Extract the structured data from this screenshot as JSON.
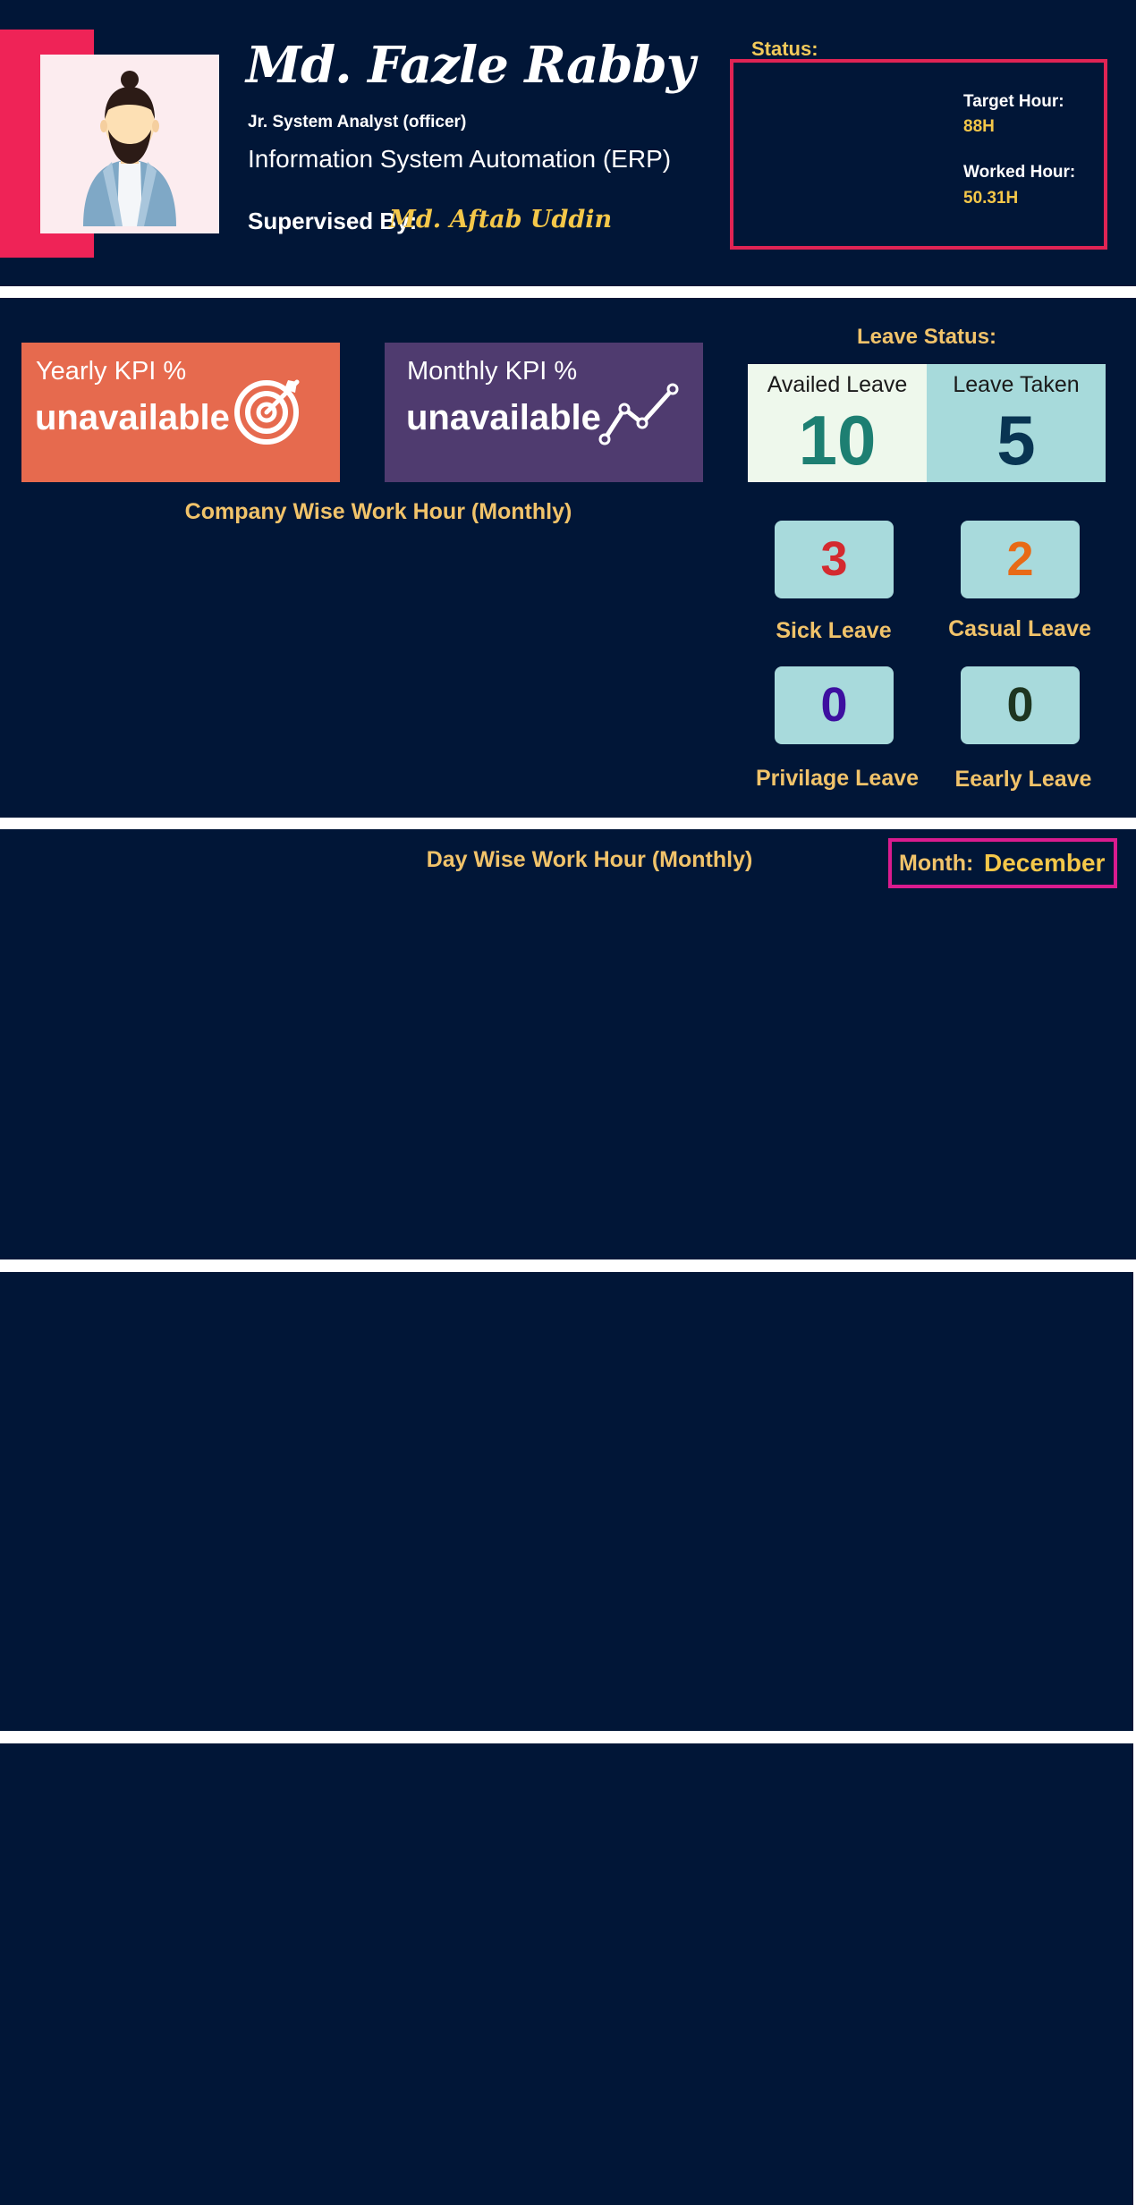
{
  "profile": {
    "name": "Md. Fazle Rabby",
    "designation": "Jr. System Analyst (officer)",
    "department": "Information System Automation (ERP)",
    "supervised_by_label": "Supervised By:",
    "supervisor": "Md. Aftab Uddin",
    "avatar_icon": "bearded-man-avatar-icon"
  },
  "status": {
    "label": "Status:",
    "target_hour_label": "Target Hour:",
    "target_hour_value": "88H",
    "worked_hour_label": "Worked Hour:",
    "worked_hour_value": "50.31H"
  },
  "kpi": {
    "yearly": {
      "title": "Yearly KPI %",
      "value": "unavailable",
      "icon": "target-icon"
    },
    "monthly": {
      "title": "Monthly KPI %",
      "value": "unavailable",
      "icon": "line-chart-icon"
    }
  },
  "company_chart": {
    "title": "Company Wise Work Hour (Monthly)"
  },
  "leave": {
    "title": "Leave Status:",
    "availed_label": "Availed Leave",
    "availed_value": "10",
    "taken_label": "Leave Taken",
    "taken_value": "5",
    "sick_value": "3",
    "sick_label": "Sick Leave",
    "casual_value": "2",
    "casual_label": "Casual Leave",
    "privilage_value": "0",
    "privilage_label": "Privilage Leave",
    "early_value": "0",
    "early_label": "Eearly Leave"
  },
  "day_chart": {
    "title": "Day Wise Work Hour (Monthly)",
    "month_label": "Month:",
    "month_value": "December"
  },
  "colors": {
    "background": "#011637",
    "accent_red": "#ef2357",
    "gold": "#f1c36a",
    "yearly_kpi": "#e66a4e",
    "monthly_kpi": "#4f3b6f",
    "leave_teal": "#a7dadb",
    "month_border": "#da1b8f"
  }
}
